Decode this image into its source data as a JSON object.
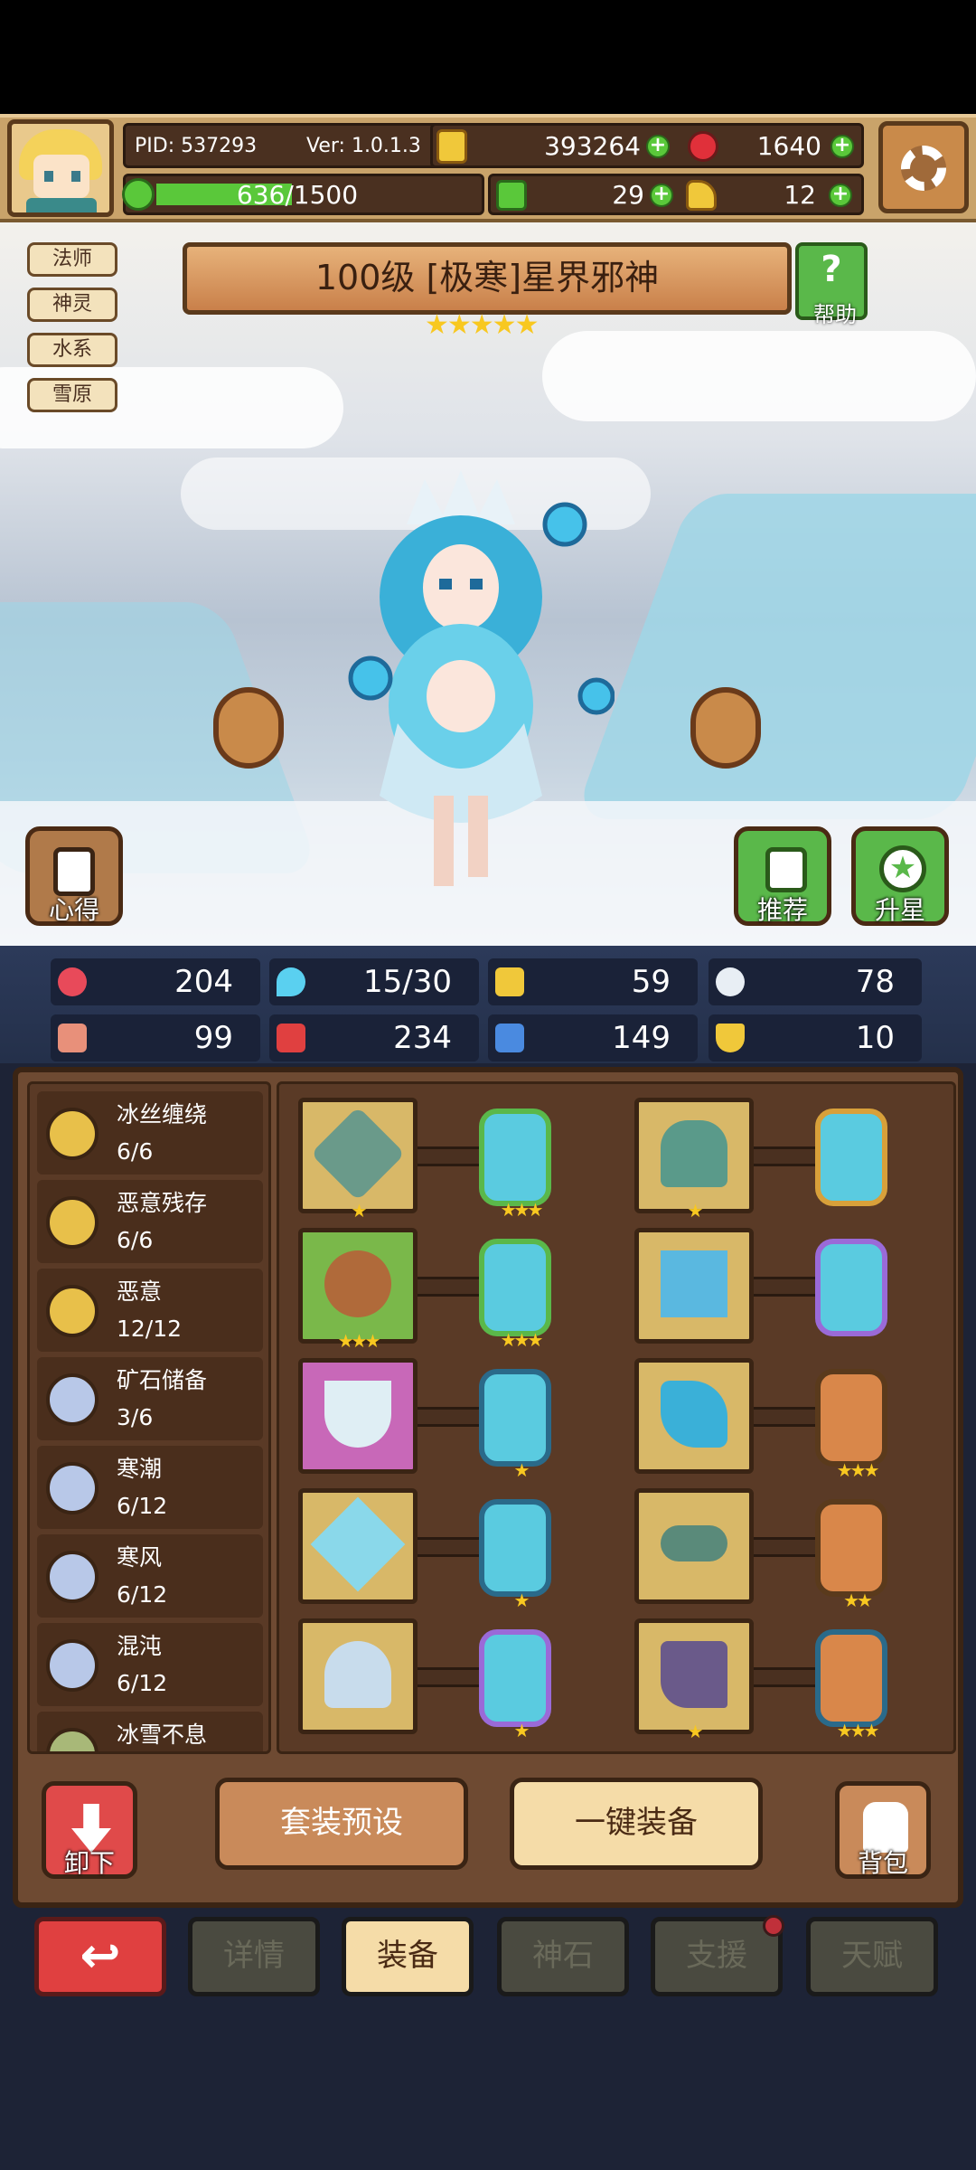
{
  "header": {
    "pid": "PID: 537293",
    "version": "Ver: 1.0.1.3",
    "gold": "393264",
    "gems": "1640",
    "exp": "636/1500",
    "clover": "29",
    "stamina": "12"
  },
  "tags": [
    "法师",
    "神灵",
    "水系",
    "雪原"
  ],
  "hero": {
    "title": "100级 [极寒]星界邪神",
    "stars": "★★★★★",
    "help_label": "帮助"
  },
  "scene_buttons": {
    "notes": "心得",
    "recommend": "推荐",
    "star_up": "升星"
  },
  "stats": [
    "204",
    "15/30",
    "59",
    "78",
    "99",
    "234",
    "149",
    "10"
  ],
  "sets": [
    {
      "name": "冰丝缠绕",
      "count": "6/6",
      "color": "#e8c04a"
    },
    {
      "name": "恶意残存",
      "count": "6/6",
      "color": "#e8c04a"
    },
    {
      "name": "恶意",
      "count": "12/12",
      "color": "#e8c04a"
    },
    {
      "name": "矿石储备",
      "count": "3/6",
      "color": "#b8c8e8"
    },
    {
      "name": "寒潮",
      "count": "6/12",
      "color": "#b8c8e8"
    },
    {
      "name": "寒风",
      "count": "6/12",
      "color": "#b8c8e8"
    },
    {
      "name": "混沌",
      "count": "6/12",
      "color": "#b8c8e8"
    },
    {
      "name": "冰雪不息",
      "count": "",
      "color": "#a8b878"
    }
  ],
  "equipment_stars": {
    "weapon": "★",
    "weapon_gem": "★★★",
    "body": "★",
    "body_gem": "",
    "bag": "★★★",
    "bag_gem": "★★★",
    "robe": "",
    "robe_gem": "",
    "necklace": "",
    "necklace_gem": "★",
    "glove": "",
    "glove_gem": "★★★",
    "crystal": "",
    "crystal_gem": "★",
    "belt": "",
    "belt_gem": "★★",
    "helm": "",
    "helm_gem": "★",
    "boots": "★",
    "boots_gem": "★★★"
  },
  "actions": {
    "unequip": "卸下",
    "preset": "套装预设",
    "auto_equip": "一键装备",
    "backpack": "背包"
  },
  "tabs": [
    "详情",
    "装备",
    "神石",
    "支援",
    "天赋"
  ],
  "colors": {
    "accent": "#e04040",
    "panel": "#6e4a32",
    "gold": "#f8c820"
  }
}
